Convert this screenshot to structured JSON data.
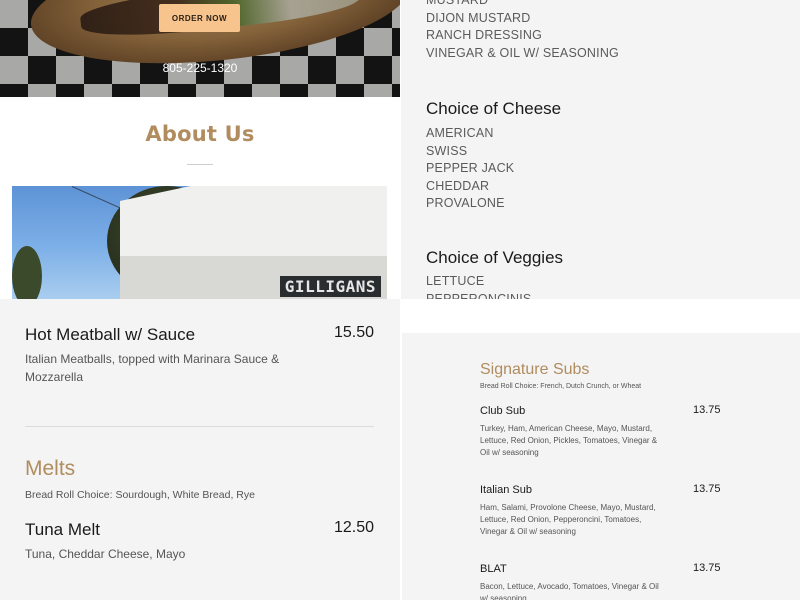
{
  "hero": {
    "order_button": "ORDER NOW",
    "phone": "805-225-1320"
  },
  "about": {
    "title": "About Us",
    "storefront_sign": "GILLIGANS"
  },
  "options": {
    "sauces": [
      "MUSTARD",
      "DIJON MUSTARD",
      "RANCH DRESSING",
      "VINEGAR & OIL W/ SEASONING"
    ],
    "cheese_heading": "Choice of Cheese",
    "cheeses": [
      "AMERICAN",
      "SWISS",
      "PEPPER JACK",
      "CHEDDAR",
      "PROVALONE"
    ],
    "veggies_heading": "Choice of Veggies",
    "veggies": [
      "LETTUCE",
      "PEPPERONCINIS"
    ]
  },
  "menu": {
    "meatball": {
      "name": "Hot Meatball w/ Sauce",
      "price": "15.50",
      "desc": "Italian Meatballs, topped with Marinara Sauce & Mozzarella"
    },
    "melts": {
      "title": "Melts",
      "note": "Bread Roll Choice: Sourdough, White Bread, Rye",
      "tuna": {
        "name": "Tuna Melt",
        "price": "12.50",
        "desc": "Tuna, Cheddar Cheese, Mayo"
      }
    }
  },
  "signature": {
    "title": "Signature Subs",
    "note": "Bread Roll Choice: French, Dutch Crunch, or Wheat",
    "items": [
      {
        "name": "Club Sub",
        "price": "13.75",
        "desc": "Turkey, Ham, American Cheese, Mayo, Mustard, Lettuce, Red Onion, Pickles, Tomatoes, Vinegar & Oil w/ seasoning"
      },
      {
        "name": "Italian Sub",
        "price": "13.75",
        "desc": "Ham, Salami, Provolone Cheese, Mayo, Mustard, Lettuce, Red Onion, Pepperoncini, Tomatoes, Vinegar & Oil w/ seasoning"
      },
      {
        "name": "BLAT",
        "price": "13.75",
        "desc": "Bacon, Lettuce, Avocado, Tomatoes, Vinegar & Oil w/ seasoning"
      }
    ]
  },
  "colors": {
    "accent": "#b08c5e",
    "button": "#f7c48d",
    "panel": "#f4f4f4"
  }
}
